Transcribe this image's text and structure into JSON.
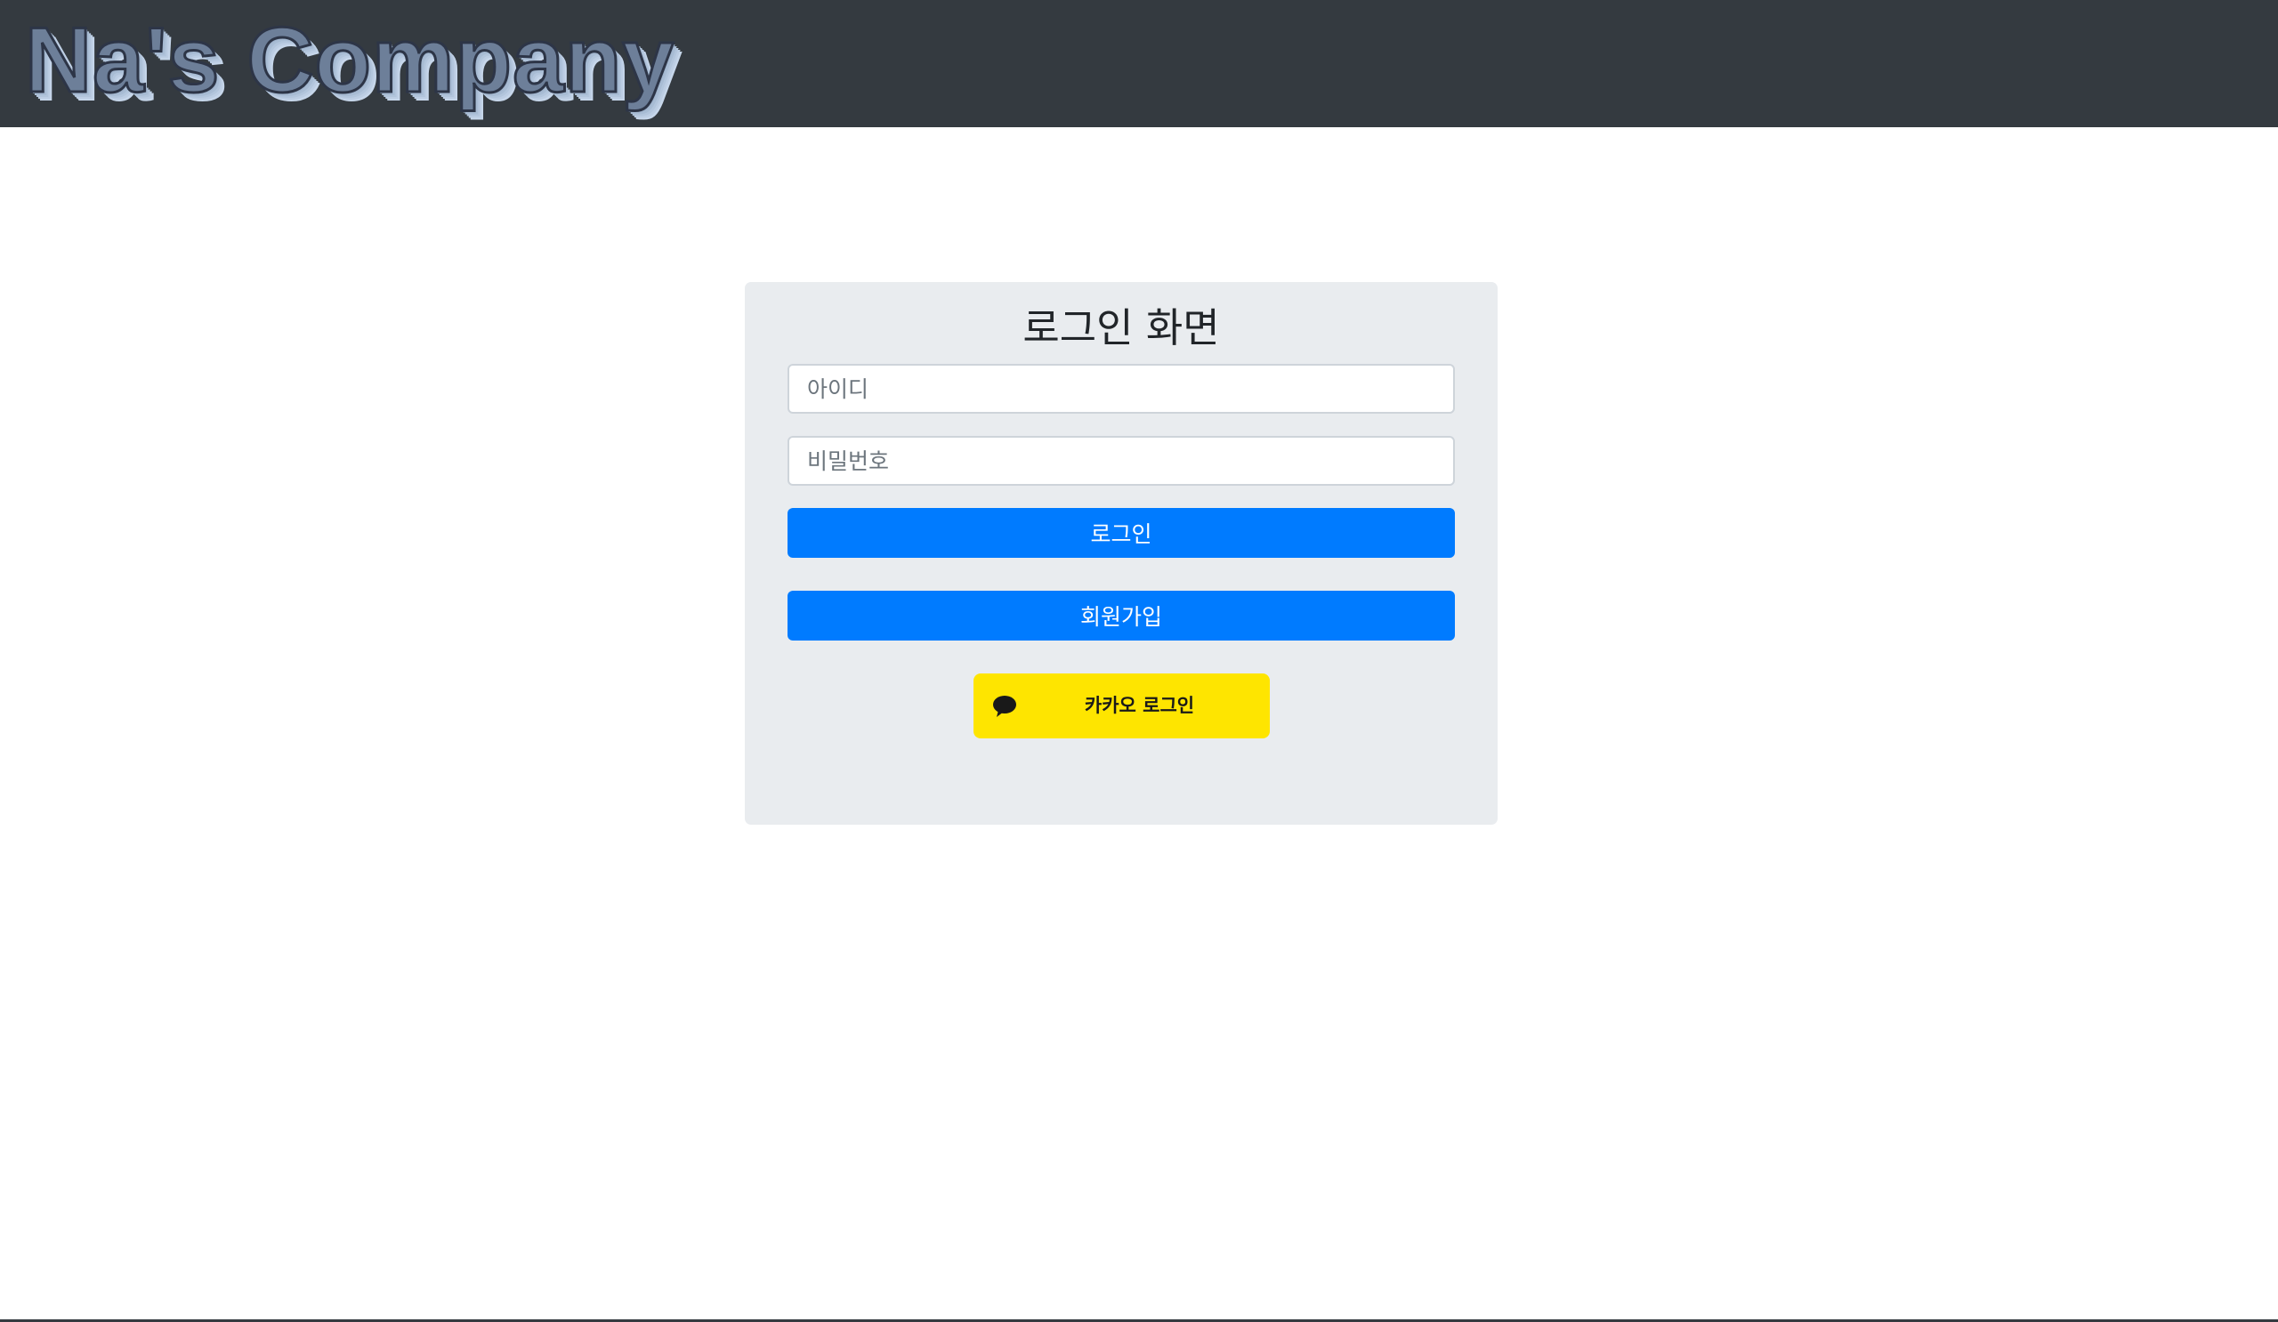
{
  "header": {
    "brand": "Na's Company"
  },
  "login": {
    "title": "로그인 화면",
    "id_placeholder": "아이디",
    "password_placeholder": "비밀번호",
    "login_label": "로그인",
    "signup_label": "회원가입",
    "kakao_label": "카카오 로그인",
    "kakao_icon": "speech-bubble-icon"
  },
  "colors": {
    "navbar": "#343a40",
    "card": "#e9ecef",
    "primary": "#007bff",
    "kakao": "#fee500"
  }
}
